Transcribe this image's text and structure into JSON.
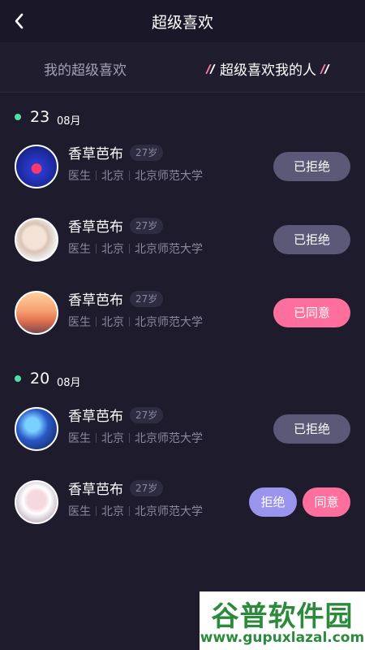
{
  "header": {
    "title": "超级喜欢",
    "back_icon": "chevron-left-icon"
  },
  "tabs": [
    {
      "label": "我的超级喜欢",
      "active": false
    },
    {
      "label": "超级喜欢我的人",
      "active": true
    }
  ],
  "colors": {
    "background": "#1d1b2c",
    "accent_pink": "#ff6f9d",
    "rejected_gray": "#5b5977",
    "reject_purple": "#9a95ec",
    "date_dot_green": "#4fe0a6"
  },
  "groups": [
    {
      "day": "23",
      "month": "08月",
      "items": [
        {
          "name": "香草芭布",
          "age": "27岁",
          "job": "医生",
          "city": "北京",
          "school": "北京师范大学",
          "status_label": "已拒绝"
        },
        {
          "name": "香草芭布",
          "age": "27岁",
          "job": "医生",
          "city": "北京",
          "school": "北京师范大学",
          "status_label": "已拒绝"
        },
        {
          "name": "香草芭布",
          "age": "27岁",
          "job": "医生",
          "city": "北京",
          "school": "北京师范大学",
          "status_label": "已同意"
        }
      ]
    },
    {
      "day": "20",
      "month": "08月",
      "items": [
        {
          "name": "香草芭布",
          "age": "27岁",
          "job": "医生",
          "city": "北京",
          "school": "北京师范大学",
          "status_label": "已拒绝"
        },
        {
          "name": "香草芭布",
          "age": "27岁",
          "job": "医生",
          "city": "北京",
          "school": "北京师范大学",
          "reject_label": "拒绝",
          "accept_label": "同意"
        }
      ]
    }
  ],
  "watermark": {
    "title": "谷普软件园",
    "url": "www.gupuxlazal.com"
  }
}
